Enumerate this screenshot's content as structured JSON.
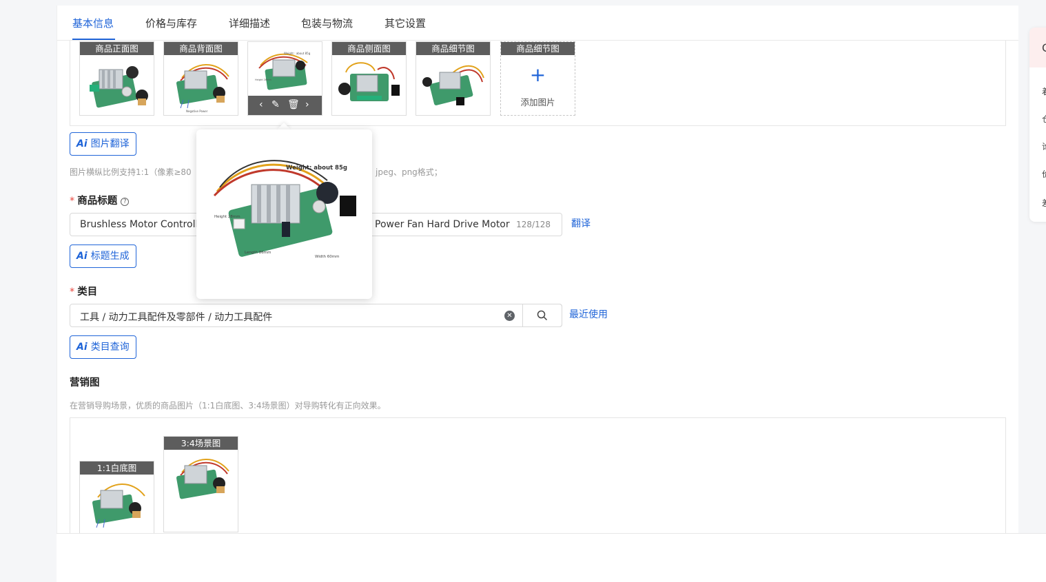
{
  "tabs": [
    {
      "label": "基本信息",
      "active": true
    },
    {
      "label": "价格与库存"
    },
    {
      "label": "详细描述"
    },
    {
      "label": "包装与物流"
    },
    {
      "label": "其它设置"
    }
  ],
  "images": {
    "slots": [
      {
        "caption": "商品正面图"
      },
      {
        "caption": "商品背面图"
      },
      {
        "caption": ""
      },
      {
        "caption": "商品侧面图"
      },
      {
        "caption": "商品细节图"
      },
      {
        "caption": "商品细节图"
      }
    ],
    "add_label": "添加图片",
    "ai_translate": "图片翻译",
    "hint": "图片横纵比例支持1:1（像素≥80",
    "hint_tail": "jpeg、png格式；",
    "preview": {
      "weight": "Weight: about 85g",
      "height": "Height 28mm",
      "length": "Length 86mm",
      "width": "Width 60mm"
    },
    "thumb_labels": {
      "small_weight": "Weight : about 85g",
      "small_height": "Height 28mm",
      "small_neg": "Negative Power"
    }
  },
  "title_field": {
    "label": "商品标题",
    "value_left": "Brushless Motor Controlle",
    "value_right": "Power Fan Hard Drive Motor",
    "counter": "128/128",
    "translate": "翻译",
    "ai_generate": "标题生成"
  },
  "category_field": {
    "label": "类目",
    "value": "工具 / 动力工具配件及零部件 / 动力工具配件",
    "recent": "最近使用",
    "ai_query": "类目查询"
  },
  "marketing": {
    "title": "营销图",
    "hint": "在营销导购场景，优质的商品图片（1:1白底图、3:4场景图）对导购转化有正向效果。",
    "slots": [
      {
        "caption": "1:1白底图"
      },
      {
        "caption": "3:4场景图"
      }
    ]
  },
  "ai_mark": "Ai",
  "right_rail": [
    "C",
    "着",
    "仓",
    "论",
    "价",
    "差"
  ],
  "colors": {
    "primary": "#1f64d8",
    "required": "#e8453c"
  }
}
